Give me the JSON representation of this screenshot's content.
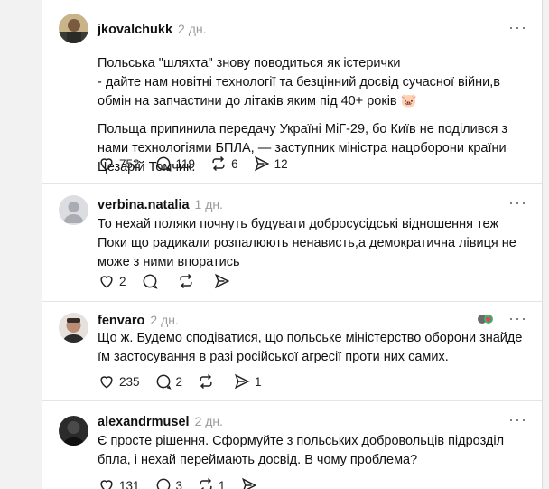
{
  "posts": [
    {
      "username": "jkovalchukk",
      "time": "2 дн.",
      "paragraphs": [
        "Польська \"шляхта\" знову поводиться як істерички",
        "- дайте нам новітні технології та безцінний досвід сучасної війни,в обмін на запчастини до літаків яким під 40+ років 🐷",
        "Польща припинила передачу Україні МіГ-29, бо Київ не поділився з нами технологіями БПЛА, — заступник міністра нацоборони країни Цезарій Томчик."
      ],
      "likes": "752",
      "comments": "119",
      "reposts": "6",
      "shares": "12"
    },
    {
      "username": "verbina.natalia",
      "time": "1 дн.",
      "paragraphs": [
        "То нехай поляки почнуть будувати добросусідські відношення теж Поки що радикали розпалюють ненависть,а демократична лівиця не може з ними впоратись"
      ],
      "likes": "2"
    },
    {
      "username": "fenvaro",
      "time": "2 дн.",
      "paragraphs": [
        "Що ж. Будемо сподіватися, що польське міністерство оборони знайде їм застосування в разі російської агресії проти них самих."
      ],
      "likes": "235",
      "comments": "2",
      "shares": "1"
    },
    {
      "username": "alexandrmusel",
      "time": "2 дн.",
      "paragraphs": [
        "Є просте рішення. Сформуйте з польських добровольців підрозділ бпла, і нехай переймають досвід. В чому проблема?"
      ],
      "likes": "131",
      "comments": "3",
      "reposts": "1"
    }
  ],
  "icons": {
    "more": "more-horizontal-icon",
    "like": "heart-icon",
    "comment": "comment-bubble-icon",
    "repost": "repost-icon",
    "share": "paper-plane-icon"
  },
  "colors": {
    "background": "#f2f2f2",
    "card": "#ffffff",
    "muted": "#9a9a9a",
    "divider": "#e4e4e4"
  }
}
